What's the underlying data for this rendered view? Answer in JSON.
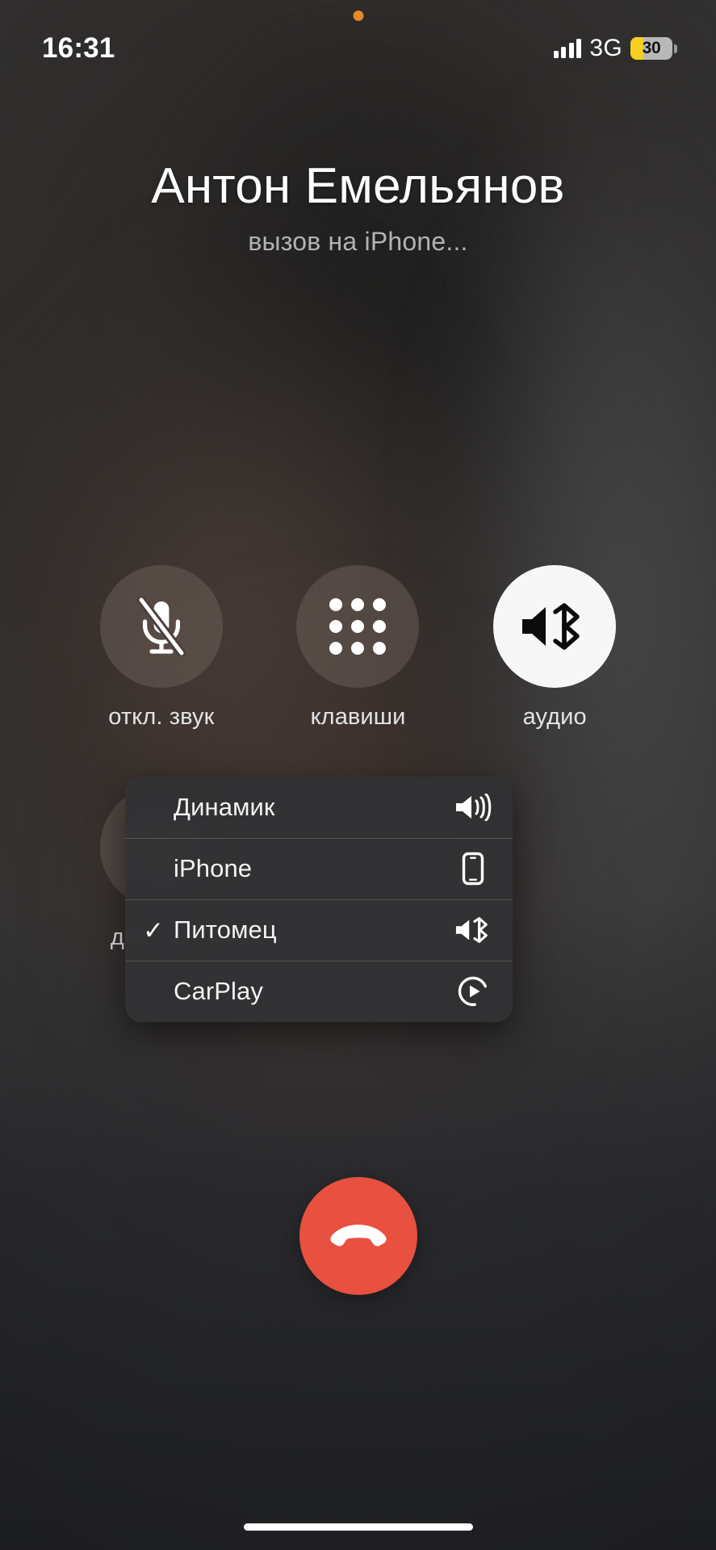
{
  "status_bar": {
    "time": "16:31",
    "network_label": "3G",
    "battery_percent": "30",
    "privacy_indicator": "orange-dot",
    "signal_bars": 4,
    "battery_fill_color": "#f5d020"
  },
  "caller": {
    "name": "Антон Емельянов",
    "status": "вызов на iPhone..."
  },
  "controls": [
    {
      "id": "mute",
      "label": "откл. звук",
      "icon": "microphone-slash-icon",
      "active": false
    },
    {
      "id": "keypad",
      "label": "клавиши",
      "icon": "keypad-dots-icon",
      "active": false
    },
    {
      "id": "audio",
      "label": "аудио",
      "icon": "speaker-bluetooth-icon",
      "active": true
    },
    {
      "id": "add-call",
      "label": "добавить",
      "icon": "plus-icon",
      "active": false
    }
  ],
  "audio_menu": {
    "items": [
      {
        "label": "Динамик",
        "icon": "speaker-waves-icon",
        "selected": false,
        "check": ""
      },
      {
        "label": "iPhone",
        "icon": "iphone-icon",
        "selected": false,
        "check": ""
      },
      {
        "label": "Питомец",
        "icon": "speaker-bluetooth-icon",
        "selected": true,
        "check": "✓"
      },
      {
        "label": "CarPlay",
        "icon": "carplay-icon",
        "selected": false,
        "check": ""
      }
    ]
  },
  "end_call": {
    "icon": "hangup-handset-icon",
    "color": "#e8503f"
  },
  "home_indicator": "home-indicator-bar"
}
